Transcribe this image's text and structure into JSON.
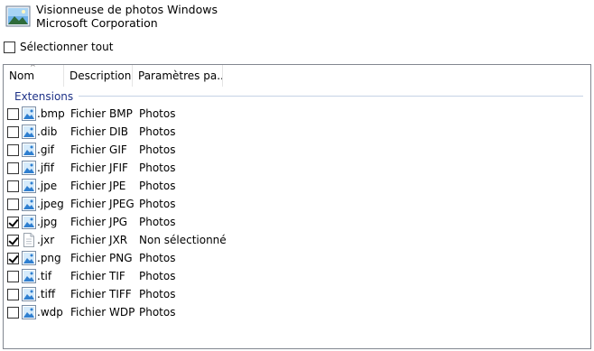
{
  "app": {
    "name": "Visionneuse de photos Windows",
    "publisher": "Microsoft Corporation",
    "icon": "photo-viewer-icon"
  },
  "select_all": {
    "label": "Sélectionner tout",
    "checked": false
  },
  "columns": {
    "name": "Nom",
    "description": "Description",
    "settings": "Paramètres pa..."
  },
  "group": {
    "title": "Extensions"
  },
  "colors": {
    "group_title": "#1e3287",
    "image_icon_blue": "#2f7fd0"
  },
  "rows": [
    {
      "ext": ".bmp",
      "description": "Fichier BMP",
      "setting": "Photos",
      "checked": false,
      "icon": "image-file-icon"
    },
    {
      "ext": ".dib",
      "description": "Fichier DIB",
      "setting": "Photos",
      "checked": false,
      "icon": "image-file-icon"
    },
    {
      "ext": ".gif",
      "description": "Fichier GIF",
      "setting": "Photos",
      "checked": false,
      "icon": "image-file-icon"
    },
    {
      "ext": ".jfif",
      "description": "Fichier JFIF",
      "setting": "Photos",
      "checked": false,
      "icon": "image-file-icon"
    },
    {
      "ext": ".jpe",
      "description": "Fichier JPE",
      "setting": "Photos",
      "checked": false,
      "icon": "image-file-icon"
    },
    {
      "ext": ".jpeg",
      "description": "Fichier JPEG",
      "setting": "Photos",
      "checked": false,
      "icon": "image-file-icon"
    },
    {
      "ext": ".jpg",
      "description": "Fichier JPG",
      "setting": "Photos",
      "checked": true,
      "icon": "image-file-icon"
    },
    {
      "ext": ".jxr",
      "description": "Fichier JXR",
      "setting": "Non sélectionné",
      "checked": true,
      "icon": "generic-file-icon"
    },
    {
      "ext": ".png",
      "description": "Fichier PNG",
      "setting": "Photos",
      "checked": true,
      "icon": "image-file-icon"
    },
    {
      "ext": ".tif",
      "description": "Fichier TIF",
      "setting": "Photos",
      "checked": false,
      "icon": "image-file-icon"
    },
    {
      "ext": ".tiff",
      "description": "Fichier TIFF",
      "setting": "Photos",
      "checked": false,
      "icon": "image-file-icon"
    },
    {
      "ext": ".wdp",
      "description": "Fichier WDP",
      "setting": "Photos",
      "checked": false,
      "icon": "image-file-icon"
    }
  ]
}
